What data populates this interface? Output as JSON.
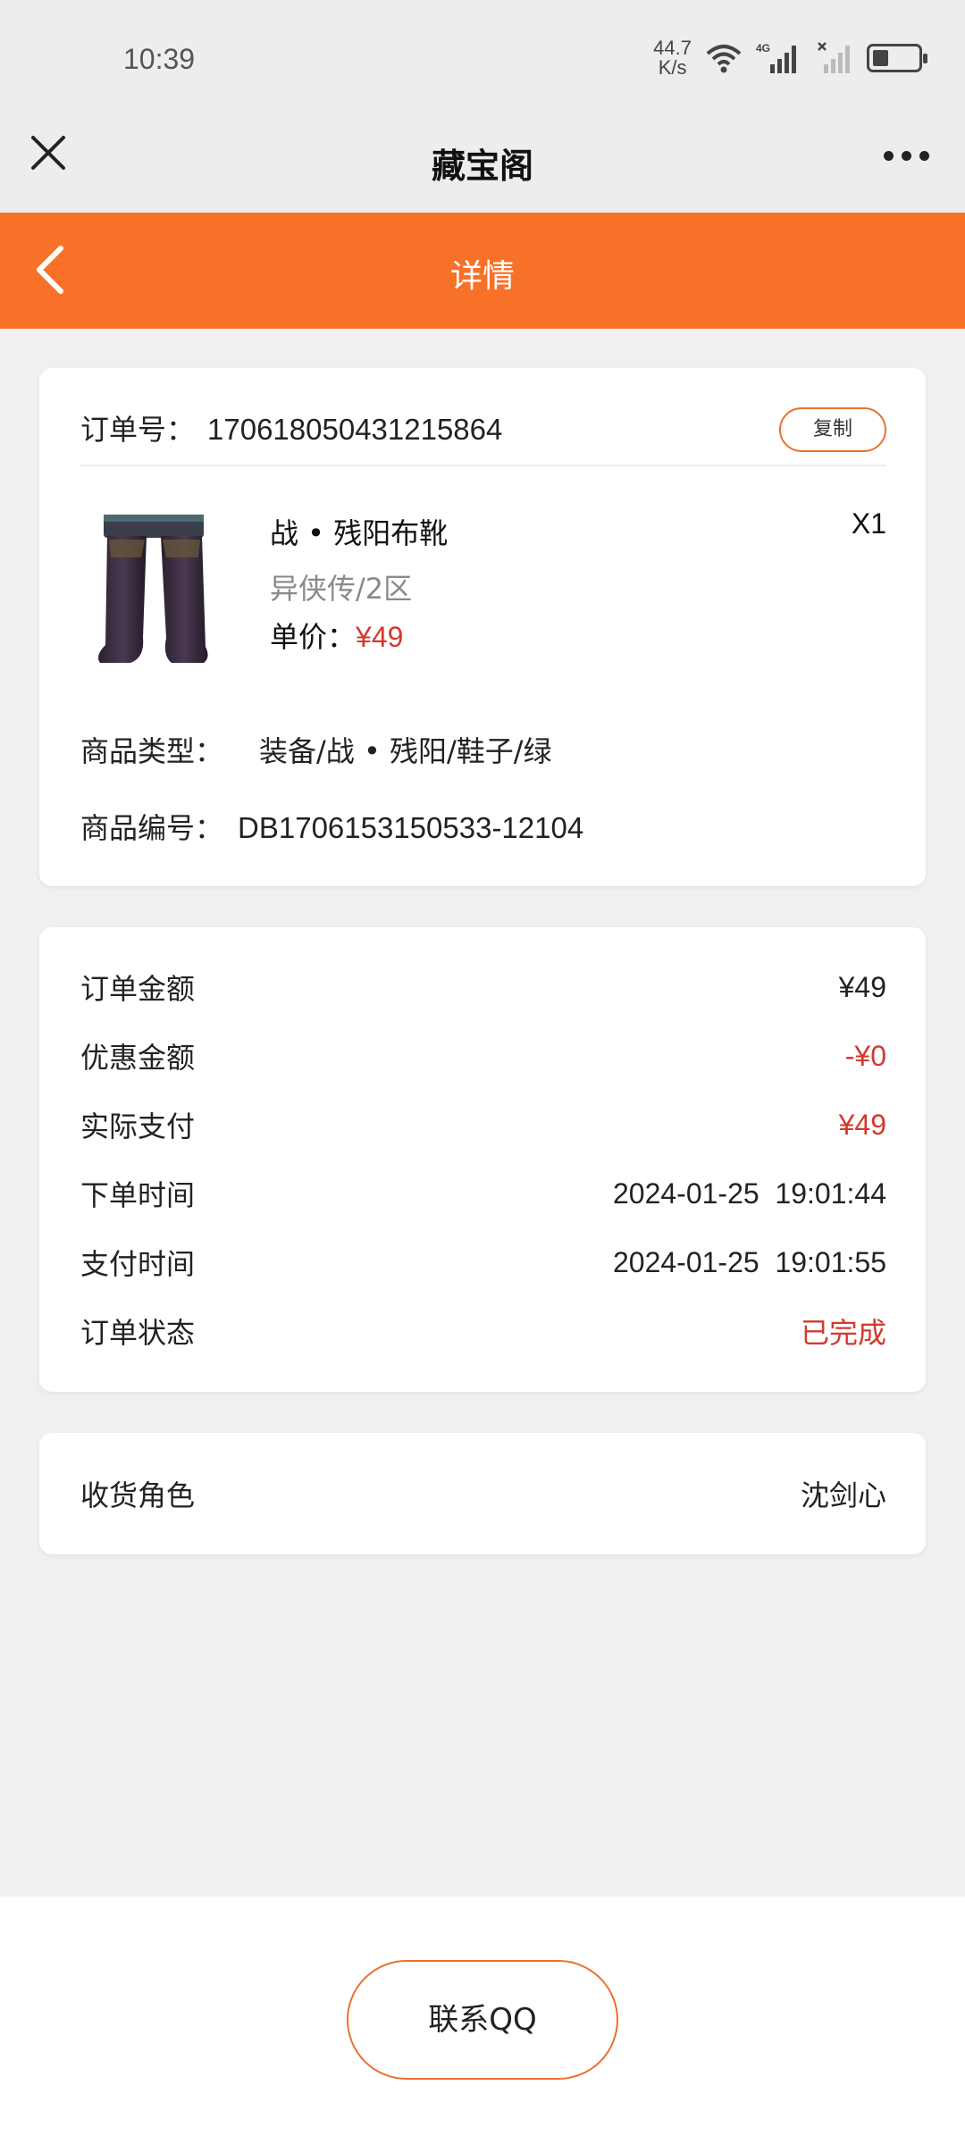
{
  "status_bar": {
    "time": "10:39",
    "net_speed_value": "44.7",
    "net_speed_unit": "K/s",
    "network_label": "4G",
    "battery_level": 0.35
  },
  "title_bar": {
    "title": "藏宝阁"
  },
  "nav": {
    "title": "详情"
  },
  "order": {
    "number_label": "订单号：",
    "number": "170618050431215864",
    "copy_label": "复制"
  },
  "product": {
    "name": "战 • 残阳布靴",
    "quantity": "X1",
    "server": "异侠传/2区",
    "price_label": "单价：",
    "price": "¥49",
    "type_label": "商品类型：",
    "type_value": "装备/战 • 残阳/鞋子/绿",
    "code_label": "商品编号：",
    "code_value": "DB1706153150533-12104"
  },
  "summary": {
    "rows": [
      {
        "label": "订单金额",
        "value": "¥49"
      },
      {
        "label": "优惠金额",
        "value": "-¥0"
      },
      {
        "label": "实际支付",
        "value": "¥49"
      },
      {
        "label": "下单时间",
        "value": "2024-01-25  19:01:44"
      },
      {
        "label": "支付时间",
        "value": "2024-01-25  19:01:55"
      },
      {
        "label": "订单状态",
        "value": "已完成"
      }
    ]
  },
  "receiver": {
    "label": "收货角色",
    "value": "沈剑心"
  },
  "footer": {
    "contact_label": "联系QQ"
  },
  "colors": {
    "accent": "#f87128",
    "price_red": "#d23a2e",
    "background": "#f0f0f0"
  }
}
